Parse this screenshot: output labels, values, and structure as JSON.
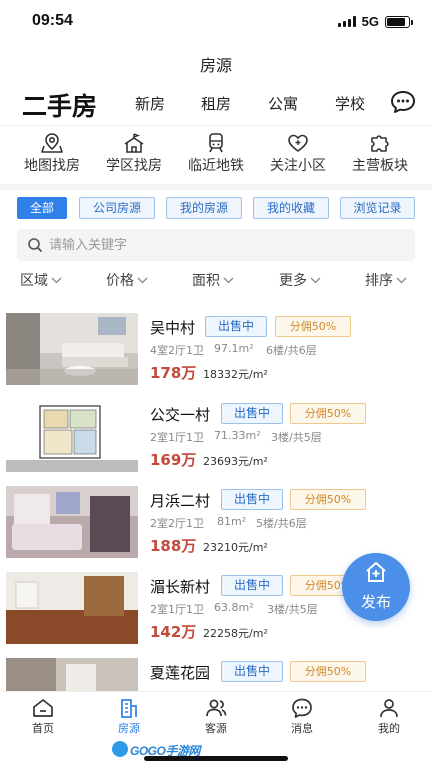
{
  "status_bar": {
    "time": "09:54",
    "network": "5G",
    "battery_level": 0.85
  },
  "page_title": "房源",
  "top_nav": {
    "active": "二手房",
    "items": [
      "新房",
      "租房",
      "公寓",
      "学校"
    ],
    "message_icon": "chat-bubble-icon"
  },
  "quick_links": [
    {
      "label": "地图找房",
      "icon": "map-pin-icon"
    },
    {
      "label": "学区找房",
      "icon": "school-icon"
    },
    {
      "label": "临近地铁",
      "icon": "subway-icon"
    },
    {
      "label": "关注小区",
      "icon": "heart-icon"
    },
    {
      "label": "主营板块",
      "icon": "puzzle-icon"
    }
  ],
  "filter_tabs": {
    "active": "全部",
    "items": [
      "全部",
      "公司房源",
      "我的房源",
      "我的收藏",
      "浏览记录"
    ]
  },
  "search": {
    "placeholder": "请输入关键字"
  },
  "sort_options": [
    "区域",
    "价格",
    "面积",
    "更多",
    "排序"
  ],
  "listings": [
    {
      "name": "吴中村",
      "status": "出售中",
      "commission": "分佣50%",
      "layout": "4室2厅1卫",
      "area": "97.1m²",
      "floor": "6楼/共6层",
      "price": "178万",
      "unit_price": "18332元/m²",
      "photo": "living-room"
    },
    {
      "name": "公交一村",
      "status": "出售中",
      "commission": "分佣50%",
      "layout": "2室1厅1卫",
      "area": "71.33m²",
      "floor": "3楼/共5层",
      "price": "169万",
      "unit_price": "23693元/m²",
      "photo": "floor-plan"
    },
    {
      "name": "月浜二村",
      "status": "出售中",
      "commission": "分佣50%",
      "layout": "2室2厅1卫",
      "area": "81m²",
      "floor": "5楼/共6层",
      "price": "188万",
      "unit_price": "23210元/m²",
      "photo": "bedroom"
    },
    {
      "name": "湄长新村",
      "status": "出售中",
      "commission": "分佣50%",
      "layout": "2室1厅1卫",
      "area": "63.8m²",
      "floor": "3楼/共5层",
      "price": "142万",
      "unit_price": "22258元/m²",
      "photo": "wood-floor-room"
    },
    {
      "name": "夏莲花园",
      "status": "出售中",
      "commission": "分佣50%",
      "layout": "",
      "area": "",
      "floor": "",
      "price": "",
      "unit_price": "",
      "photo": "room"
    }
  ],
  "fab": {
    "label": "发布",
    "icon": "house-plus-icon"
  },
  "tab_bar": {
    "active": "房源",
    "items": [
      {
        "label": "首页",
        "icon": "home-icon"
      },
      {
        "label": "房源",
        "icon": "building-icon"
      },
      {
        "label": "客源",
        "icon": "users-icon"
      },
      {
        "label": "消息",
        "icon": "message-icon"
      },
      {
        "label": "我的",
        "icon": "person-icon"
      }
    ]
  },
  "watermark": {
    "text": "GOGO手游网"
  },
  "colors": {
    "accent": "#2f80e8",
    "price": "#c34a3a",
    "commission": "#d18a2a"
  }
}
